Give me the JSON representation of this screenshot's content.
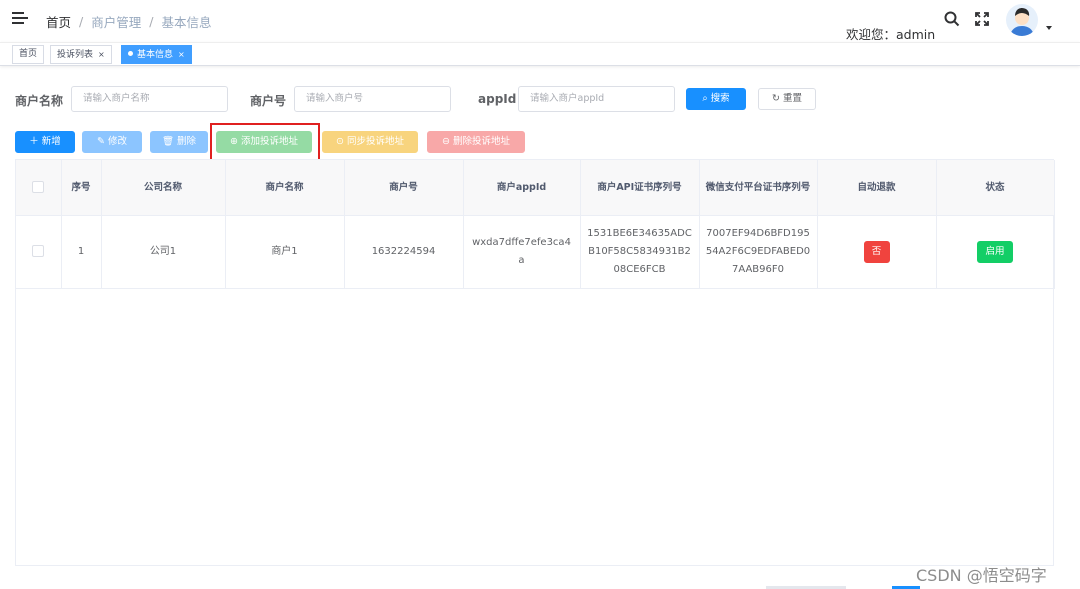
{
  "breadcrumb": [
    "首页",
    "商户管理",
    "基本信息"
  ],
  "breadcrumb_sep": "/",
  "header": {
    "welcome": "欢迎您：admin"
  },
  "tags": [
    {
      "label": "首页"
    },
    {
      "label": "投诉列表",
      "close": "×"
    },
    {
      "label": "基本信息",
      "close": "×",
      "active": true
    }
  ],
  "search": {
    "merchant_name_label": "商户名称",
    "merchant_name_placeholder": "请输入商户名称",
    "merchant_no_label": "商户号",
    "merchant_no_placeholder": "请输入商户号",
    "appid_label": "appId",
    "appid_placeholder": "请输入商户appId",
    "search_btn": "搜索",
    "reset_btn": "重置"
  },
  "toolbar": {
    "add": "新增",
    "edit": "修改",
    "delete": "删除",
    "add_complaint": "添加投诉地址",
    "sync_complaint": "同步投诉地址",
    "delete_complaint": "删除投诉地址"
  },
  "table": {
    "columns": [
      "序号",
      "公司名称",
      "商户名称",
      "商户号",
      "商户appId",
      "商户API证书序列号",
      "微信支付平台证书序列号",
      "自动退款",
      "状态"
    ],
    "rows": [
      {
        "index": "1",
        "company": "公司1",
        "merchant_name": "商户1",
        "merchant_no": "1632224594",
        "appid": "wxda7dffe7efe3ca4a",
        "api_cert_serial": "1531BE6E34635ADCB10F58C5834931B208CE6FCB",
        "wechat_cert_serial": "7007EF94D6BFD19554A2F6C9EDFABED07AAB96F0",
        "auto_refund": "否",
        "status": "启用"
      }
    ]
  },
  "watermark": "CSDN @悟空码字",
  "colors": {
    "primary": "#1890ff",
    "success": "#13ce66",
    "danger": "#f0433e",
    "highlight": "#e02020"
  }
}
